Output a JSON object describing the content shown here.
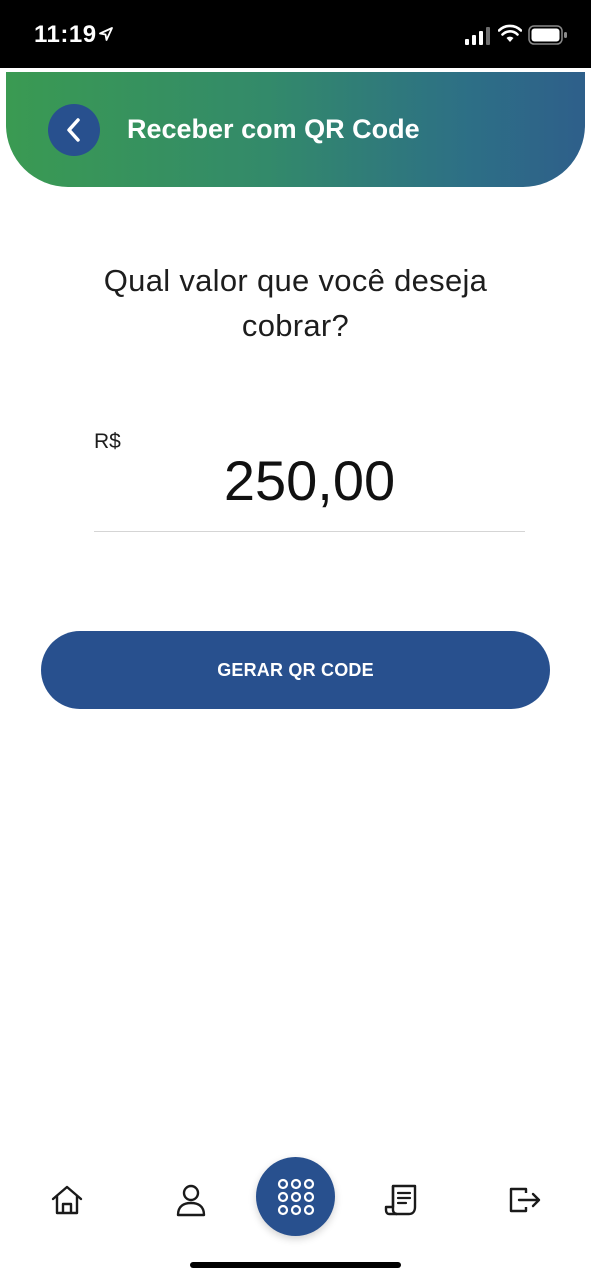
{
  "status_bar": {
    "time": "11:19"
  },
  "header": {
    "title": "Receber com QR Code",
    "back_icon": "chevron-left-icon"
  },
  "question": "Qual valor que você deseja cobrar?",
  "amount": {
    "currency": "R$",
    "value": "250,00"
  },
  "generate_button": {
    "label": "GERAR QR CODE"
  },
  "bottom_nav": {
    "items": [
      {
        "icon": "home-icon"
      },
      {
        "icon": "user-icon"
      },
      {
        "icon": "grid-menu-icon"
      },
      {
        "icon": "receipt-icon"
      },
      {
        "icon": "logout-icon"
      }
    ]
  },
  "colors": {
    "primary": "#28508e",
    "header_gradient_start": "#3a9a52",
    "header_gradient_end": "#2e5f8a"
  }
}
